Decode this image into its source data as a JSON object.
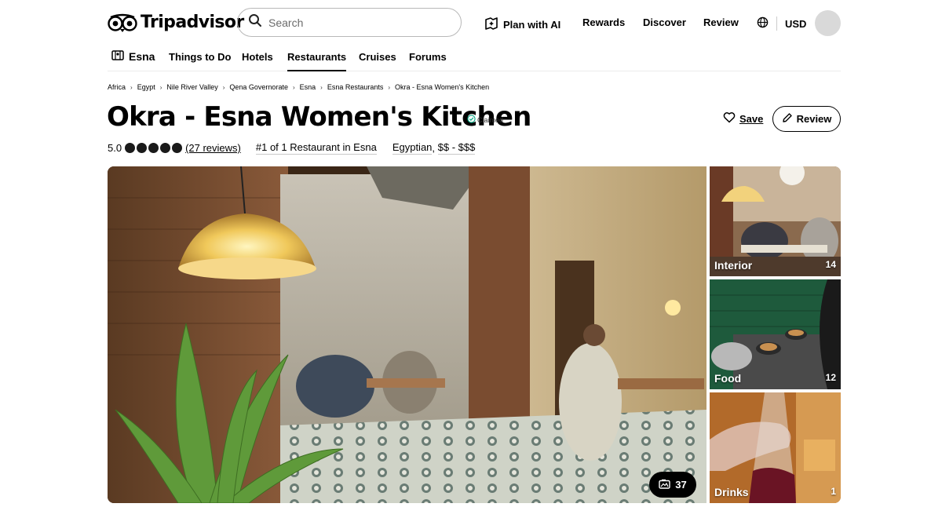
{
  "brand": {
    "name": "Tripadvisor"
  },
  "search": {
    "placeholder": "Search"
  },
  "top_nav": {
    "plan_ai": "Plan with AI",
    "rewards": "Rewards",
    "discover": "Discover",
    "review": "Review",
    "currency": "USD"
  },
  "category_nav": {
    "location": "Esna",
    "items": [
      "Things to Do",
      "Hotels",
      "Restaurants",
      "Cruises",
      "Forums"
    ],
    "active": "Restaurants"
  },
  "breadcrumbs": [
    "Africa",
    "Egypt",
    "Nile River Valley",
    "Qena Governorate",
    "Esna",
    "Esna Restaurants",
    "Okra - Esna Women's Kitchen"
  ],
  "restaurant": {
    "name": "Okra - Esna Women's Kitchen",
    "claimed": "Claimed",
    "rating": "5.0",
    "rating_value": 5,
    "reviews": "(27 reviews)",
    "rank": "#1 of 1 Restaurant in Esna",
    "cuisine": "Egyptian",
    "price": "$$ - $$$"
  },
  "actions": {
    "save": "Save",
    "review": "Review"
  },
  "photos": {
    "total": "37",
    "categories": [
      {
        "label": "Interior",
        "count": "14"
      },
      {
        "label": "Food",
        "count": "12"
      },
      {
        "label": "Drinks",
        "count": "1"
      }
    ]
  },
  "colors": {
    "text": "#000000",
    "border": "#b8b8b8",
    "rating_bubble": "#1a1a1a"
  },
  "icons": [
    "search-icon",
    "plan-ai-icon",
    "globe-icon",
    "map-icon",
    "heart-icon",
    "pencil-icon",
    "camera-icon",
    "check-badge-icon"
  ]
}
